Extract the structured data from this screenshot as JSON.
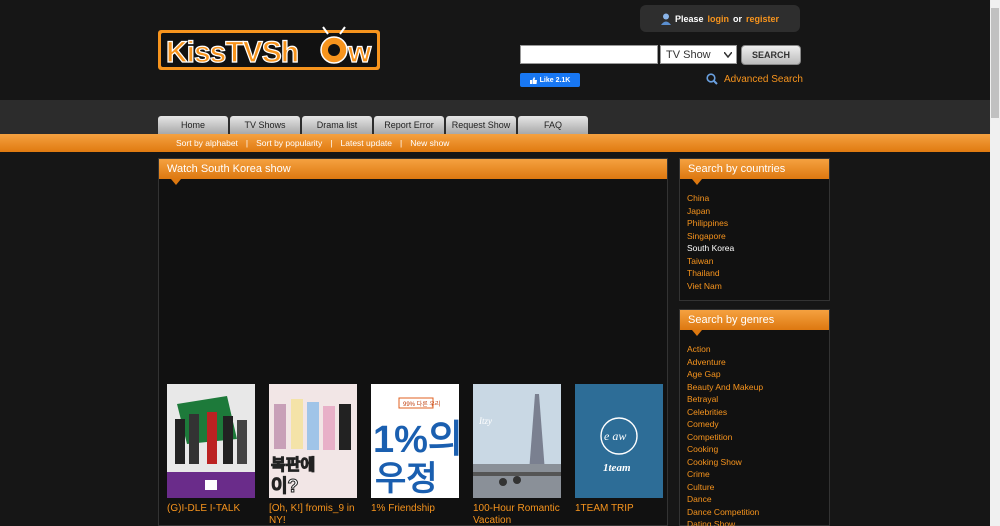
{
  "header": {
    "logo_text": "KissTVShow",
    "login": {
      "prefix": "Please",
      "login": "login",
      "or": "or",
      "register": "register"
    },
    "search": {
      "placeholder": "",
      "category": "TV Show",
      "button": "SEARCH"
    },
    "fb_like": "Like 2.1K",
    "advanced_search": "Advanced Search"
  },
  "nav": {
    "tabs": [
      "Home",
      "TV Shows",
      "Drama list",
      "Report Error",
      "Request Show",
      "FAQ"
    ],
    "sub": [
      "Sort by alphabet",
      "Sort by popularity",
      "Latest update",
      "New show"
    ]
  },
  "main": {
    "title": "Watch South Korea show",
    "shows": [
      {
        "title": "(G)I-DLE I-TALK",
        "thumb_icon": "group-photo-thumbnail"
      },
      {
        "title": "[Oh, K!] fromis_9 in NY!",
        "thumb_icon": "girls-photo-thumbnail"
      },
      {
        "title": "1% Friendship",
        "thumb_icon": "1-percent-poster-thumbnail"
      },
      {
        "title": "100-Hour Romantic Vacation",
        "thumb_icon": "eiffel-tower-thumbnail"
      },
      {
        "title": "1TEAM TRIP",
        "thumb_icon": "1team-logo-thumbnail"
      }
    ]
  },
  "countries": {
    "title": "Search by countries",
    "items": [
      "China",
      "Japan",
      "Philippines",
      "Singapore",
      "South Korea",
      "Taiwan",
      "Thailand",
      "Viet Nam"
    ],
    "active": "South Korea"
  },
  "genres": {
    "title": "Search by genres",
    "items": [
      "Action",
      "Adventure",
      "Age Gap",
      "Beauty And Makeup",
      "Betrayal",
      "Celebrities",
      "Comedy",
      "Competition",
      "Cooking",
      "Cooking Show",
      "Crime",
      "Culture",
      "Dance",
      "Dance Competition",
      "Dating Show"
    ]
  },
  "colors": {
    "accent": "#f7941d",
    "background": "#161616"
  }
}
